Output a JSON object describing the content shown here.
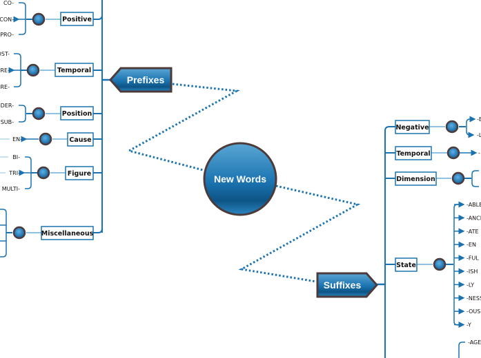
{
  "diagram": {
    "type": "mind-map",
    "center": {
      "label": "New Words"
    },
    "colors": {
      "primary": "#1a73b0",
      "primary_dark": "#0d5485",
      "light_line": "#8fc3e3",
      "border_dark": "#4d3b3b",
      "box_border": "#1a73b0",
      "background": "#ffffff"
    },
    "branches": [
      {
        "label": "Prefixes",
        "groups": [
          {
            "label": "Positive",
            "items": [
              "CO-",
              "CON-",
              "PRO-"
            ]
          },
          {
            "label": "Temporal",
            "items": [
              "POST-",
              "PRE-",
              "FORE-"
            ]
          },
          {
            "label": "Position",
            "items": [
              "UNDER-",
              "SUB-"
            ]
          },
          {
            "label": "Cause",
            "items": [
              "EN-"
            ]
          },
          {
            "label": "Figure",
            "items": [
              "BI-",
              "TRI-",
              "MULTI-"
            ]
          },
          {
            "label": "Miscellaneous",
            "items": [
              "",
              "",
              ""
            ]
          }
        ]
      },
      {
        "label": "Suffixes",
        "groups": [
          {
            "label": "Negative",
            "items": [
              "-E",
              "-L"
            ]
          },
          {
            "label": "Temporal",
            "items": [
              "-"
            ]
          },
          {
            "label": "Dimension",
            "items": [
              "",
              ""
            ]
          },
          {
            "label": "State",
            "items": [
              "-ABLE",
              "-ANCE",
              "-ATE",
              "-EN",
              "-FUL",
              "-ISH",
              "-LY",
              "-NESS",
              "-OUS",
              "-Y"
            ]
          },
          {
            "label": "",
            "items": [
              "-AGE",
              "-"
            ]
          }
        ]
      }
    ]
  }
}
